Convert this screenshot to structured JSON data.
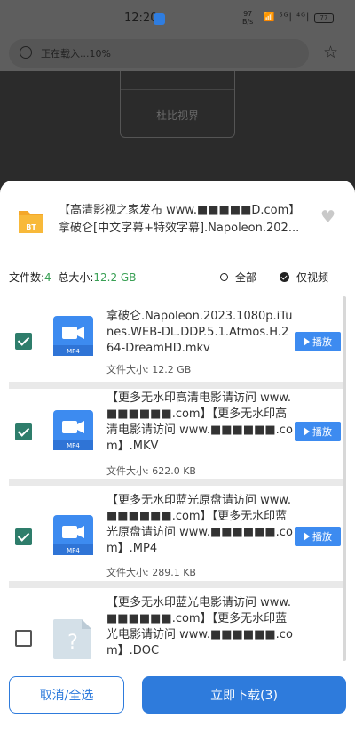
{
  "status_bar": {
    "time": "12:20",
    "speed_value": "97",
    "speed_unit": "B/s",
    "signal_icons": "📶 ⁵ᴳ| ⁴ᴳ|",
    "battery": "77"
  },
  "browser": {
    "url_text": "正在载入...10%"
  },
  "background_page": {
    "label": "杜比视界"
  },
  "sheet": {
    "title_line1": "【高清影视之家发布 www.■■■■■D.com】",
    "title_line2": "拿破仑[中文字幕+特效字幕].Napoleon.202...",
    "stats": {
      "file_count_label": "文件数:",
      "file_count": "4",
      "total_size_label": "总大小:",
      "total_size": "12.2 GB"
    },
    "filter": {
      "all_label": "全部",
      "video_only_label": "仅视频",
      "selected": "video_only"
    },
    "files": [
      {
        "name": "拿破仑.Napoleon.2023.1080p.iTunes.WEB-DL.DDP.5.1.Atmos.H.264-DreamHD.mkv",
        "size": "文件大小: 12.2 GB",
        "checked": true,
        "icon": "mp4-video-icon",
        "icon_label": "MP4",
        "play_label": "播放"
      },
      {
        "name": "【更多无水印高清电影请访问 www.■■■■■■.com】【更多无水印高清电影请访问 www.■■■■■■.com】.MKV",
        "size": "文件大小: 622.0 KB",
        "checked": true,
        "icon": "mp4-video-icon",
        "icon_label": "MP4",
        "play_label": "播放"
      },
      {
        "name": "【更多无水印蓝光原盘请访问 www.■■■■■■.com】【更多无水印蓝光原盘请访问 www.■■■■■■.com】.MP4",
        "size": "文件大小: 289.1 KB",
        "checked": true,
        "icon": "mp4-video-icon",
        "icon_label": "MP4",
        "play_label": "播放"
      },
      {
        "name": "【更多无水印蓝光电影请访问 www.■■■■■■.com】【更多无水印蓝光电影请访问 www.■■■■■■.com】.DOC",
        "checked": false,
        "icon": "unknown-file-icon",
        "icon_label": "?"
      }
    ],
    "cancel_label": "取消/全选",
    "download_label": "立即下载(3)"
  },
  "colors": {
    "accent_blue": "#2e7bdc",
    "check_green": "#2e7d6b",
    "size_green": "#3aa055",
    "video_icon_blue": "#3d8bf0"
  }
}
